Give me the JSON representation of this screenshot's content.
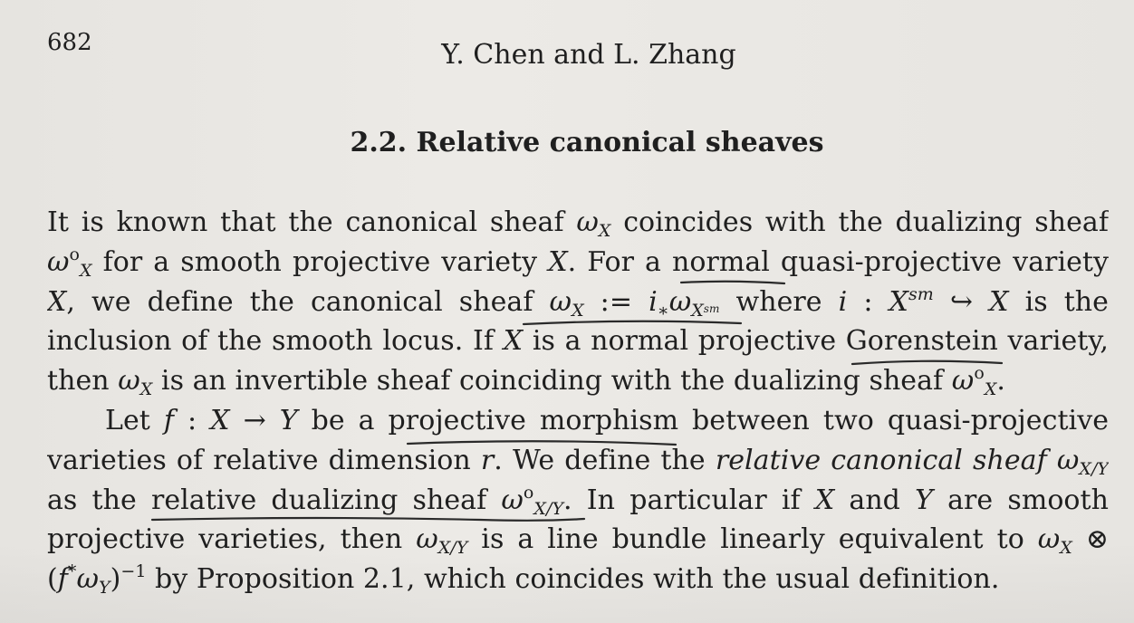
{
  "page_number": "682",
  "running_head": "Y. Chen and L. Zhang",
  "section": {
    "number": "2.2.",
    "title": "Relative canonical sheaves"
  },
  "paragraph1": {
    "l1a": "It is known that the canonical sheaf ",
    "l1b": "ω",
    "l1c": "X",
    "l1d": " coincides with the dualizing sheaf",
    "l2a": "ω",
    "l2b": "o",
    "l2c": "X",
    "l2d": " for a smooth projective variety ",
    "l2e": "X",
    "l2f": ". For a normal quasi-projective variety",
    "l3a": "X",
    "l3b": ", we define the canonical sheaf ",
    "l3c": "ω",
    "l3d": "X",
    "l3e": " := ",
    "l3f": "i",
    "l3g": "∗",
    "l3h": "ω",
    "l3i": "X",
    "l3j": "sm",
    "l3k": " where ",
    "l3l": "i",
    "l3m": " : ",
    "l3n": "X",
    "l3o": "sm",
    "l3p": " ↪ ",
    "l3q": "X",
    "l3r": " is the",
    "l4a": "inclusion of the smooth locus. If ",
    "l4b": "X",
    "l4c": " is a normal projective Gorenstein variety,",
    "l5a": "then ",
    "l5b": "ω",
    "l5c": "X",
    "l5d": " is an invertible sheaf coinciding with the dualizing sheaf ",
    "l5e": "ω",
    "l5f": "o",
    "l5g": "X",
    "l5h": "."
  },
  "paragraph2": {
    "l1a": "Let ",
    "l1b": "f",
    "l1c": " : ",
    "l1d": "X",
    "l1e": " → ",
    "l1f": "Y",
    "l1g": " be a projective morphism between two quasi-projective",
    "l2a": "varieties of relative dimension ",
    "l2b": "r",
    "l2c": ". We define the ",
    "l2d": "relative canonical sheaf",
    "l2e": " ω",
    "l2f": "X/Y",
    "l3a": "as the relative dualizing sheaf ",
    "l3b": "ω",
    "l3c": "o",
    "l3d": "X/Y",
    "l3e": ". In particular if ",
    "l3f": "X",
    "l3g": " and ",
    "l3h": "Y",
    "l3i": " are smooth",
    "l4a": "projective varieties, then ",
    "l4b": "ω",
    "l4c": "X/Y",
    "l4d": " is a line bundle linearly equivalent to ",
    "l4e": "ω",
    "l4f": "X",
    "l4g": " ⊗",
    "l5a": "(",
    "l5b": "f",
    "l5c": "*",
    "l5d": "ω",
    "l5e": "Y",
    "l5f": ")",
    "l5g": "−1",
    "l5h": " by Proposition 2.1, which coincides with the usual definition."
  }
}
